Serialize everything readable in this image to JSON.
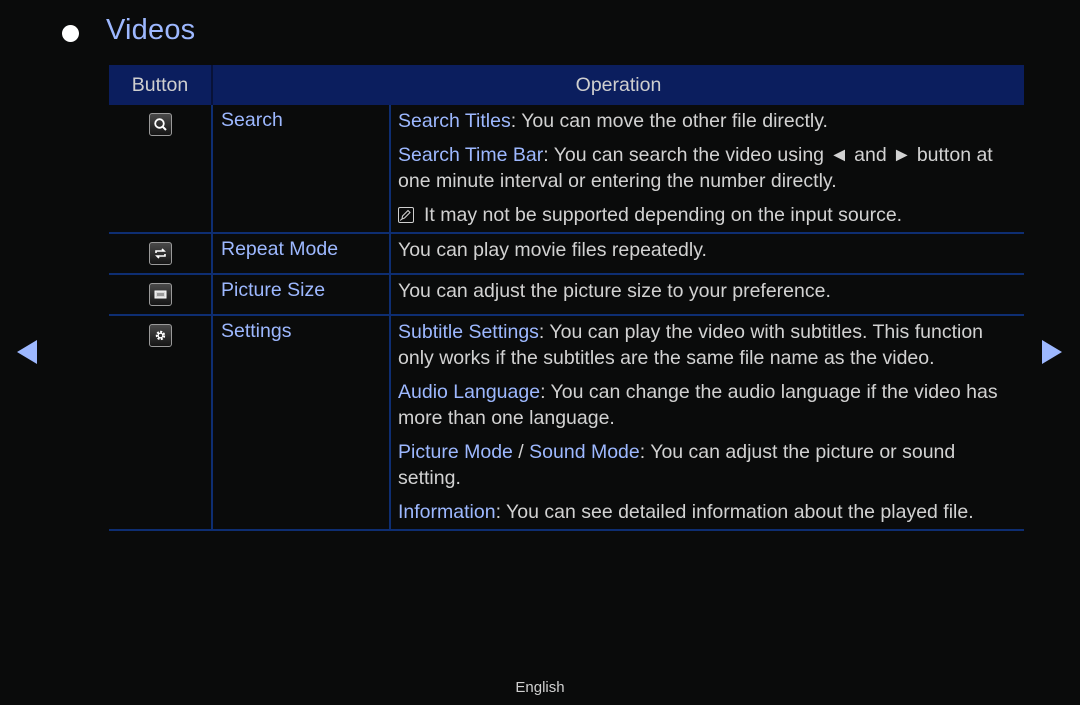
{
  "page": {
    "title": "Videos",
    "footer_language": "English"
  },
  "colors": {
    "background": "#0a0b0b",
    "accent_text": "#9db8ff",
    "header_bg": "#0b1e5e",
    "grid_line": "#0e2e72",
    "body_text": "#d2d2d2"
  },
  "table": {
    "headers": {
      "button": "Button",
      "operation": "Operation"
    },
    "rows": [
      {
        "icon": "search-icon",
        "name": "Search",
        "paras": [
          {
            "term": "Search Titles",
            "text": ": You can move the other file directly."
          },
          {
            "term": "Search Time Bar",
            "text": ": You can search the video using ◄ and ► button at one minute interval or entering the number directly."
          }
        ],
        "note": "It may not be supported depending on the input source."
      },
      {
        "icon": "repeat-icon",
        "name": "Repeat Mode",
        "text": "You can play movie files repeatedly."
      },
      {
        "icon": "picture-size-icon",
        "name": "Picture Size",
        "text": "You can adjust the picture size to your preference."
      },
      {
        "icon": "settings-icon",
        "name": "Settings",
        "paras": [
          {
            "term": "Subtitle Settings",
            "text": ": You can play the video with subtitles. This function only works if the subtitles are the same file name as the video."
          },
          {
            "term": "Audio Language",
            "text": ": You can change the audio language if the video has more than one language."
          },
          {
            "term": "Picture Mode",
            "sep": " / ",
            "term2": "Sound Mode",
            "text": ": You can adjust the picture or sound setting."
          },
          {
            "term": "Information",
            "text": ": You can see detailed information about the played file."
          }
        ]
      }
    ]
  },
  "nav": {
    "prev_icon": "triangle-left-icon",
    "next_icon": "triangle-right-icon"
  }
}
